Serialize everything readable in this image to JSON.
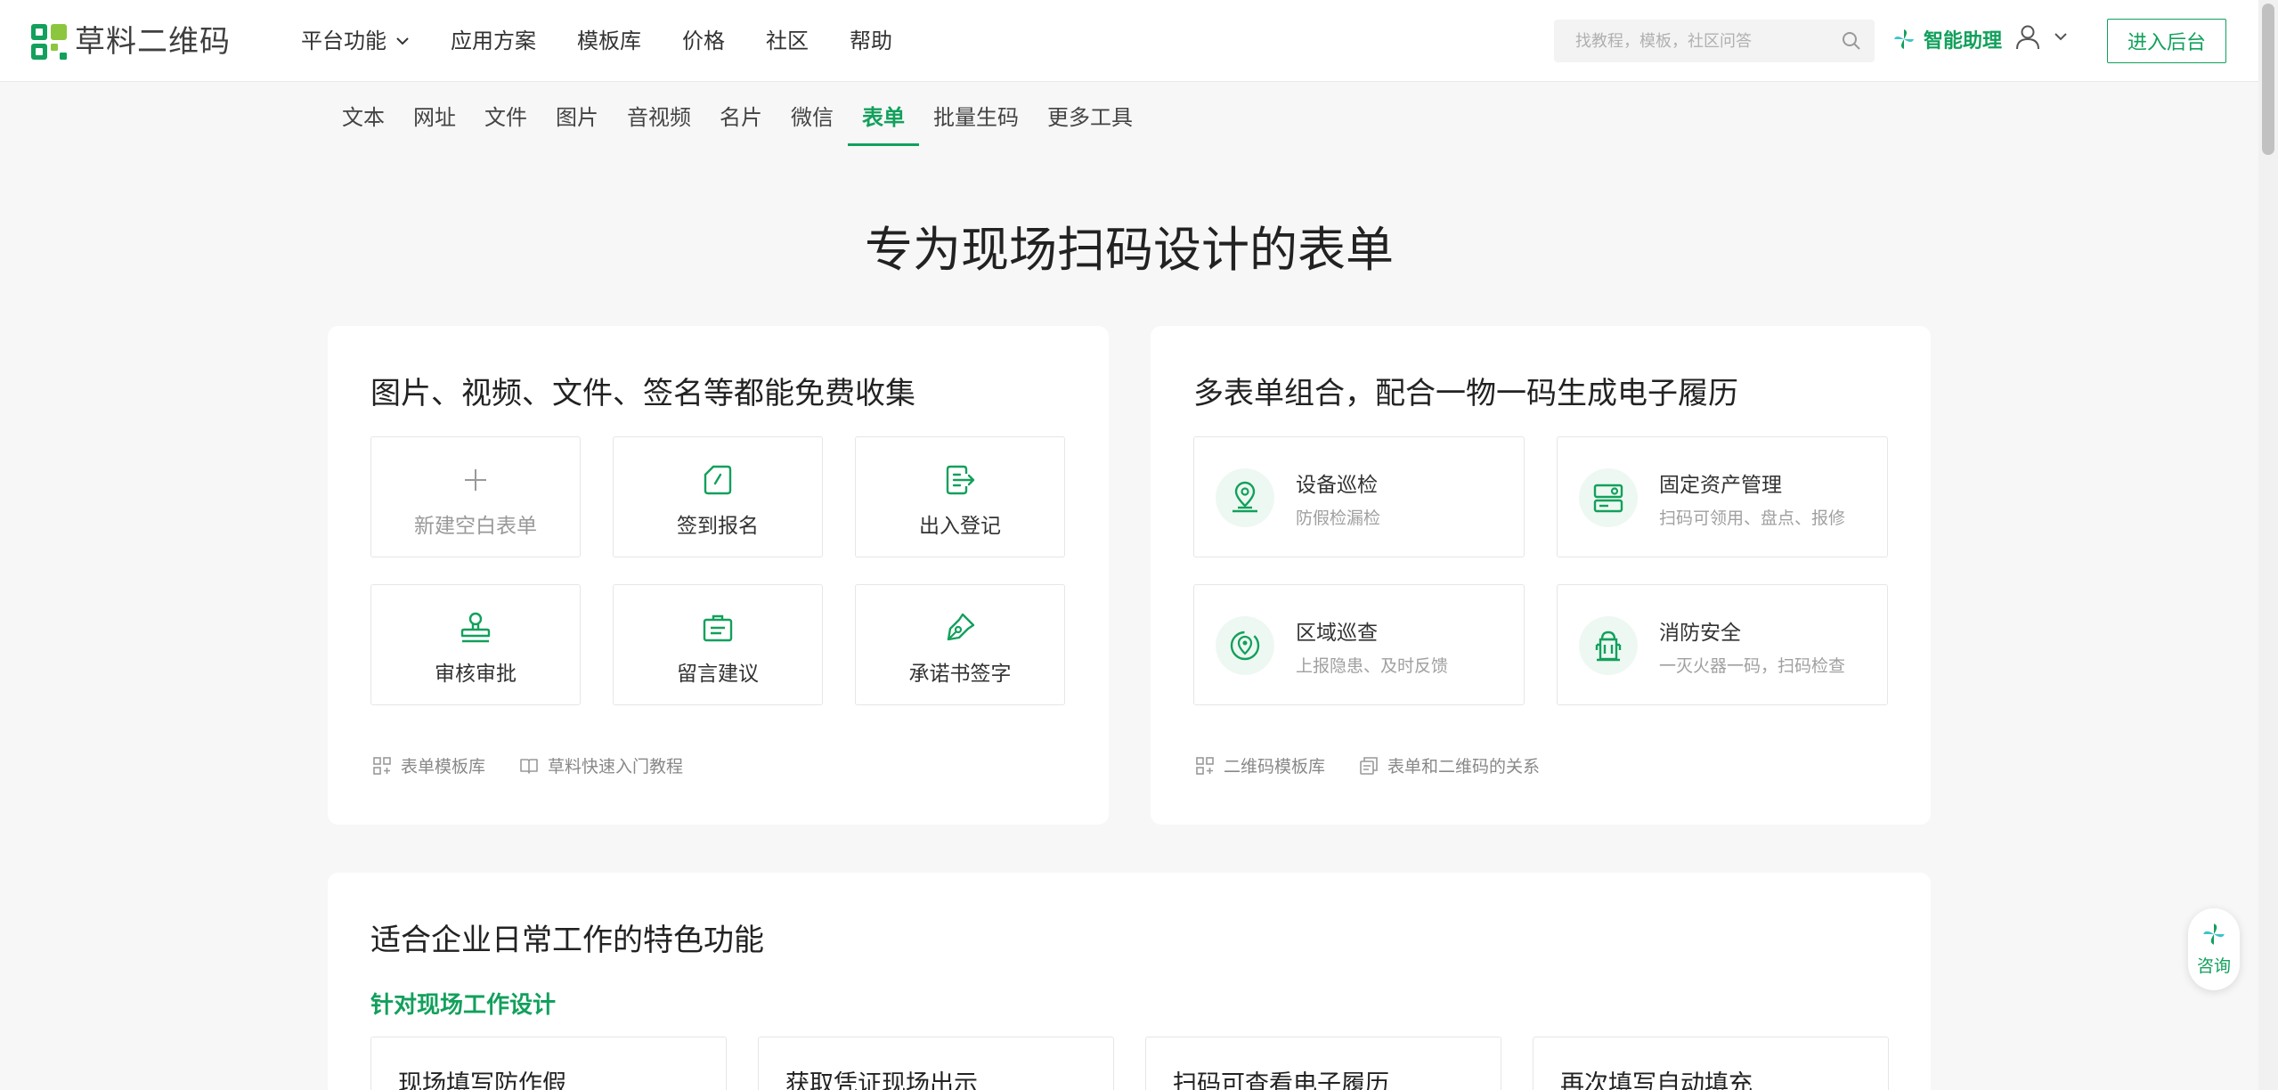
{
  "brand": {
    "name": "草料二维码",
    "accent": "#12a05c",
    "logo_colors": [
      "#12a05c",
      "#8cc63f"
    ]
  },
  "header": {
    "nav": [
      {
        "label": "平台功能",
        "has_dropdown": true
      },
      {
        "label": "应用方案"
      },
      {
        "label": "模板库"
      },
      {
        "label": "价格"
      },
      {
        "label": "社区"
      },
      {
        "label": "帮助"
      }
    ],
    "search_placeholder": "找教程，模板，社区问答",
    "assistant_label": "智能助理",
    "enter_button": "进入后台"
  },
  "subtabs": [
    "文本",
    "网址",
    "文件",
    "图片",
    "音视频",
    "名片",
    "微信",
    "表单",
    "批量生码",
    "更多工具"
  ],
  "active_subtab": "表单",
  "hero_title": "专为现场扫码设计的表单",
  "left_card": {
    "title": "图片、视频、文件、签名等都能免费收集",
    "tiles": [
      {
        "label": "新建空白表单",
        "icon": "plus-icon"
      },
      {
        "label": "签到报名",
        "icon": "edit-note-icon"
      },
      {
        "label": "出入登记",
        "icon": "exit-register-icon"
      },
      {
        "label": "审核审批",
        "icon": "stamp-icon"
      },
      {
        "label": "留言建议",
        "icon": "briefcase-message-icon"
      },
      {
        "label": "承诺书签字",
        "icon": "pen-nib-icon"
      }
    ],
    "links": [
      {
        "label": "表单模板库",
        "icon": "template-grid-icon"
      },
      {
        "label": "草料快速入门教程",
        "icon": "book-icon"
      }
    ]
  },
  "right_card": {
    "title": "多表单组合，配合一物一码生成电子履历",
    "tiles": [
      {
        "title": "设备巡检",
        "subtitle": "防假检漏检",
        "icon": "location-pin-icon"
      },
      {
        "title": "固定资产管理",
        "subtitle": "扫码可领用、盘点、报修",
        "icon": "asset-icon"
      },
      {
        "title": "区域巡查",
        "subtitle": "上报隐患、及时反馈",
        "icon": "area-patrol-icon"
      },
      {
        "title": "消防安全",
        "subtitle": "一灭火器一码，扫码检查",
        "icon": "fire-hydrant-icon"
      }
    ],
    "links": [
      {
        "label": "二维码模板库",
        "icon": "template-grid-icon"
      },
      {
        "label": "表单和二维码的关系",
        "icon": "copy-icon"
      }
    ]
  },
  "features": {
    "title": "适合企业日常工作的特色功能",
    "subtitle": "针对现场工作设计",
    "items": [
      "现场填写防作假",
      "获取凭证现场出示",
      "扫码可查看电子履历",
      "再次填写自动填充"
    ]
  },
  "consult_label": "咨询"
}
